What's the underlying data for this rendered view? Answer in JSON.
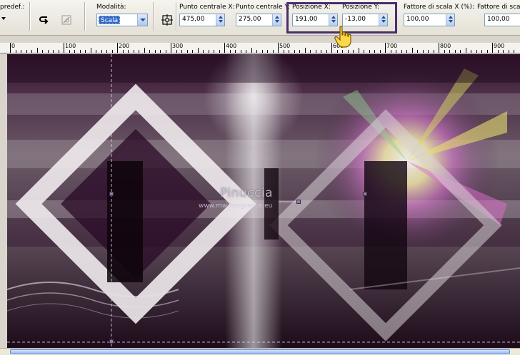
{
  "toolbar": {
    "preset_label": "predef.:",
    "modality_label": "Modalità:",
    "modality_value": "Scala",
    "center_x_label": "Punto centrale X:",
    "center_x_value": "475,00",
    "center_y_label": "Punto centrale Y:",
    "center_y_value": "275,00",
    "pos_x_label": "Posizione X:",
    "pos_x_value": "191,00",
    "pos_y_label": "Posizione Y:",
    "pos_y_value": "-13,00",
    "scale_x_label": "Fattore di scala X (%):",
    "scale_x_value": "100,00",
    "scale_y_label": "Fattore di scala",
    "scale_y_value": "100,00",
    "highlight_color": "#4a2e6c"
  },
  "ruler": {
    "labels": [
      "0",
      "100",
      "200",
      "300",
      "400",
      "500",
      "600",
      "700",
      "800",
      "900"
    ]
  },
  "canvas": {
    "watermark_title": "Pinuccia",
    "watermark_url": "www.maidiregrafica.eu"
  },
  "icons": {
    "preset": "chevron-down-icon",
    "reset": "reset-arrow-icon",
    "apply": "apply-icon",
    "center": "center-target-icon",
    "cursor": "hand-pointer-icon"
  }
}
